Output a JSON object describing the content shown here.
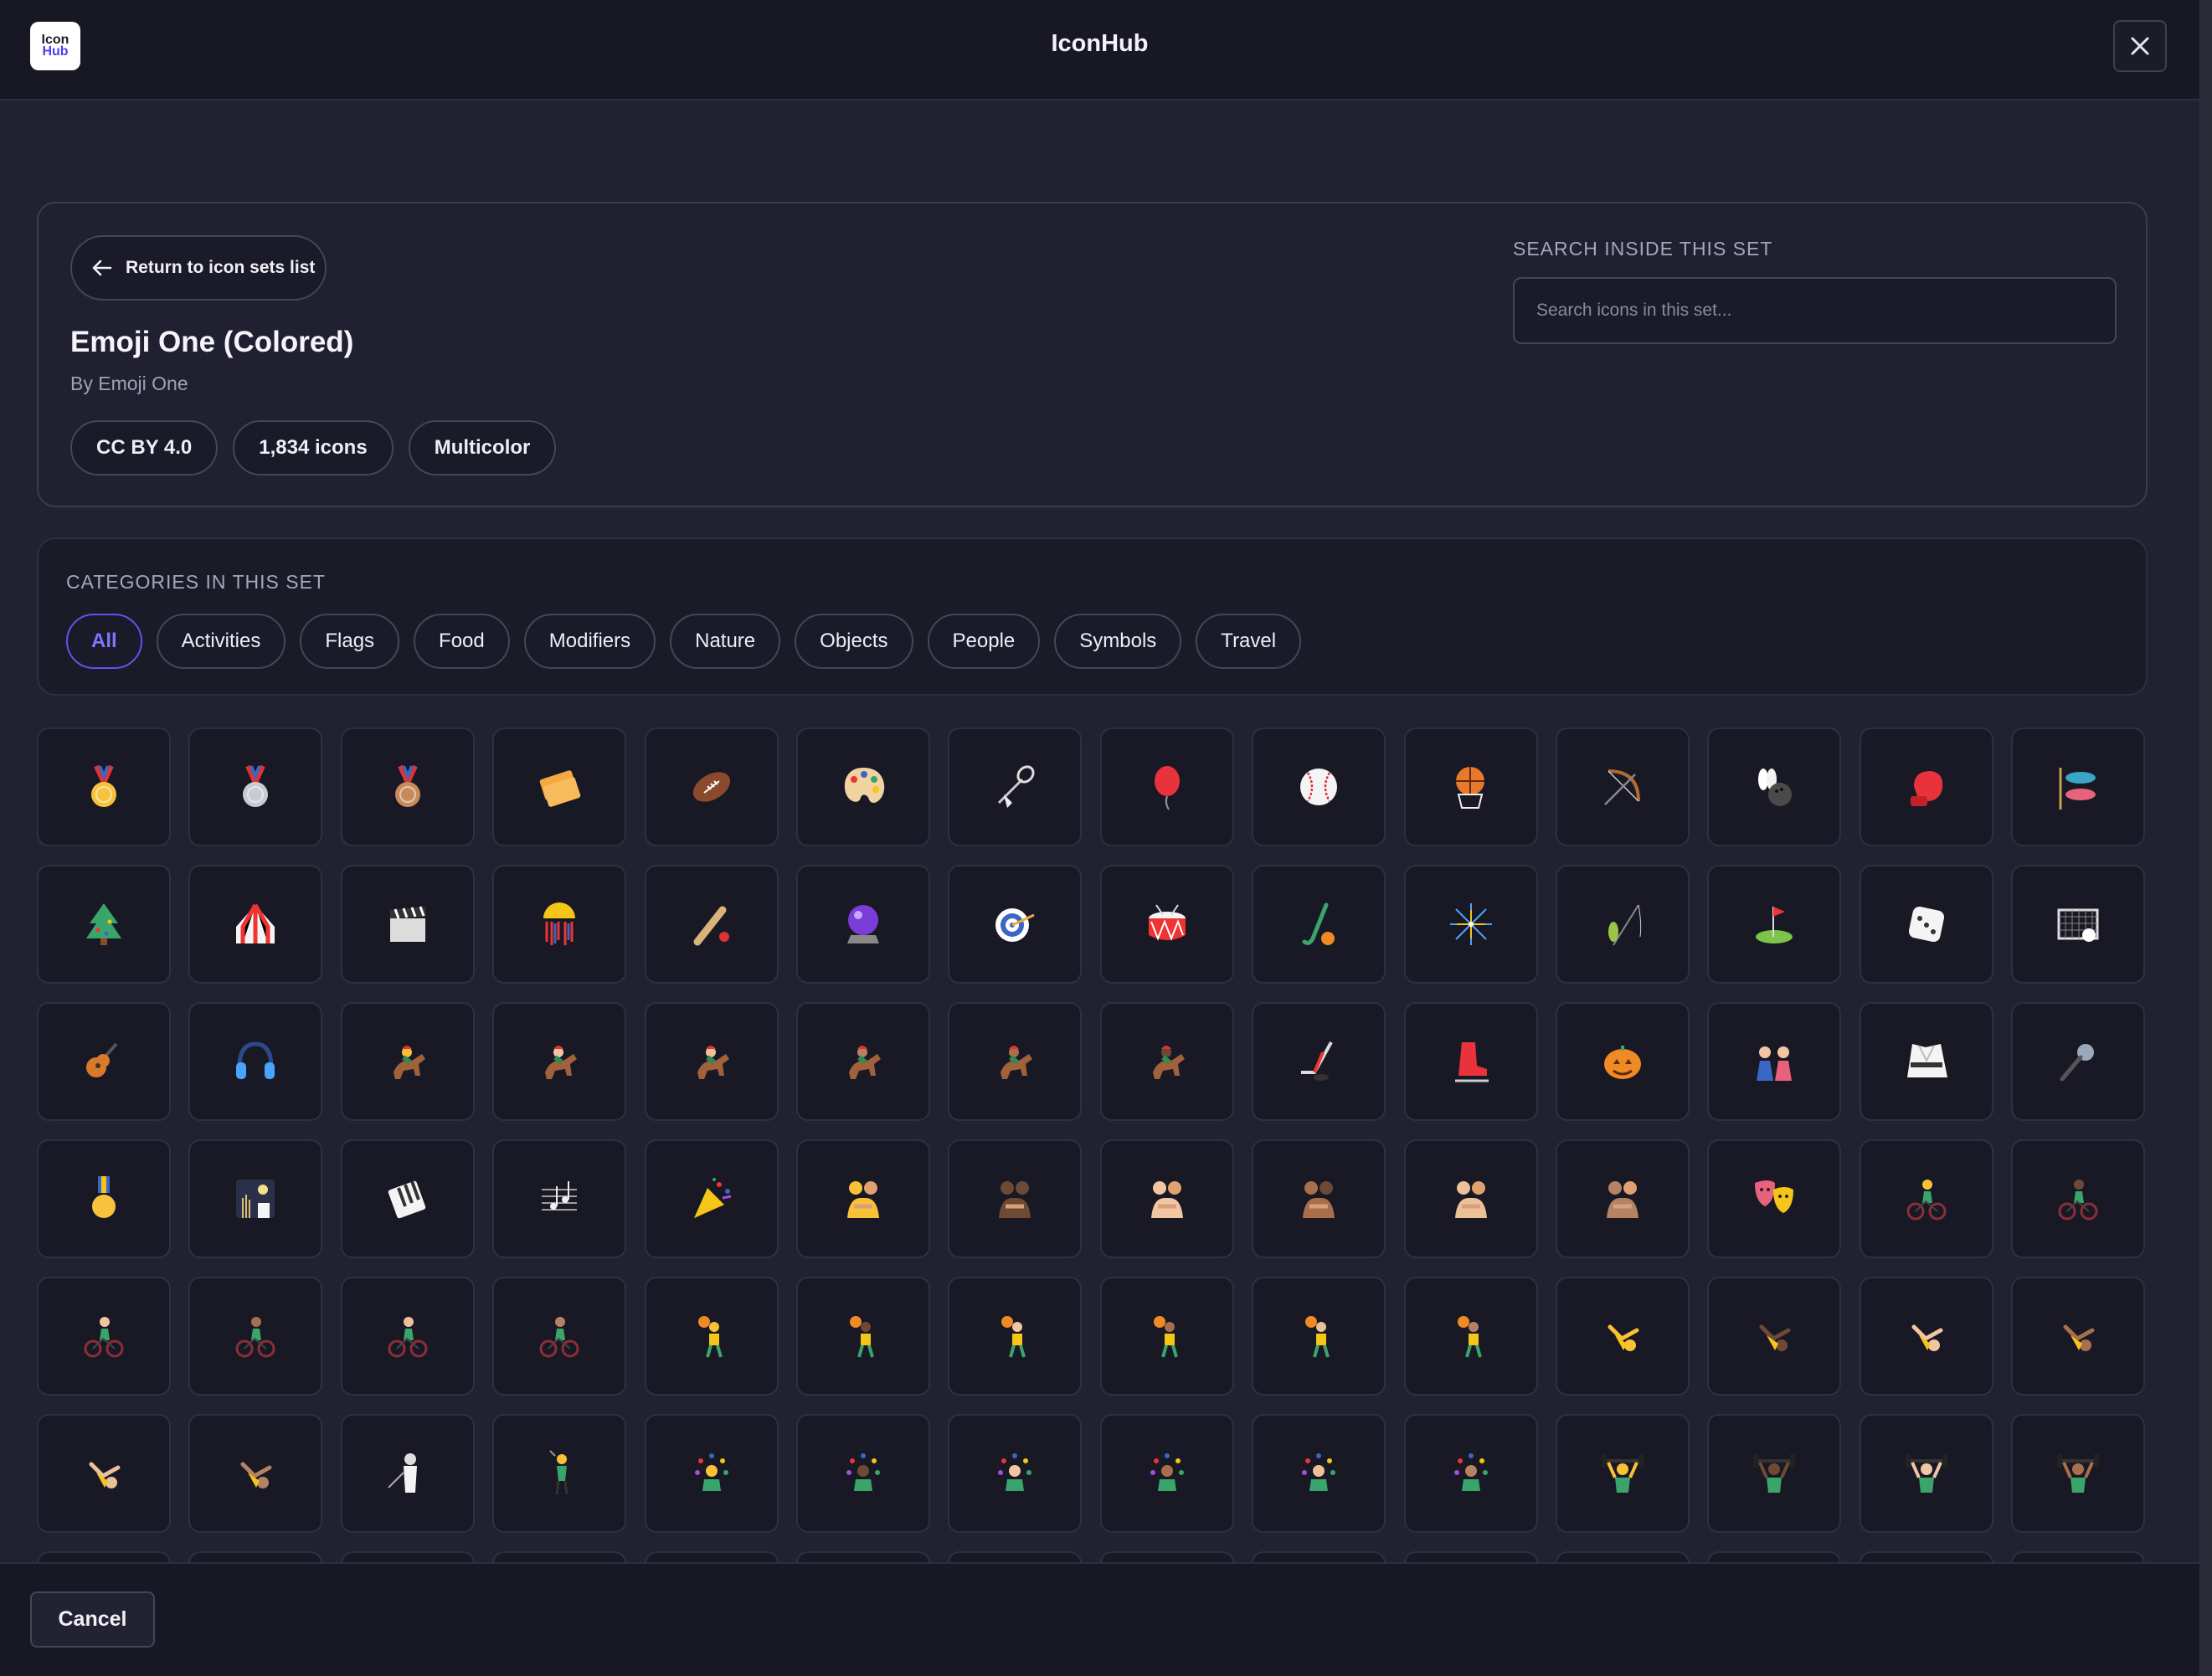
{
  "app": {
    "title": "IconHub",
    "logo_line1": "Icon",
    "logo_line2": "Hub"
  },
  "header": {
    "close_icon": "close-icon"
  },
  "set": {
    "back_label": "Return to icon sets list",
    "name": "Emoji One (Colored)",
    "author": "By Emoji One",
    "badges": [
      "CC BY 4.0",
      "1,834 icons",
      "Multicolor"
    ]
  },
  "search": {
    "label": "SEARCH INSIDE THIS SET",
    "placeholder": "Search icons in this set...",
    "value": ""
  },
  "categories": {
    "label": "CATEGORIES IN THIS SET",
    "items": [
      "All",
      "Activities",
      "Flags",
      "Food",
      "Modifiers",
      "Nature",
      "Objects",
      "People",
      "Symbols",
      "Travel"
    ],
    "active": "All"
  },
  "icons": [
    "medal-gold-icon",
    "medal-silver-icon",
    "medal-bronze-icon",
    "admission-tickets-icon",
    "american-football-icon",
    "artist-palette-icon",
    "badminton-icon",
    "balloon-icon",
    "baseball-icon",
    "basketball-icon",
    "bow-and-arrow-icon",
    "bowling-icon",
    "boxing-glove-icon",
    "carp-streamer-icon",
    "christmas-tree-icon",
    "circus-tent-icon",
    "clapper-board-icon",
    "confetti-ball-icon",
    "cricket-icon",
    "crystal-ball-icon",
    "direct-hit-icon",
    "drum-icon",
    "field-hockey-icon",
    "fireworks-icon",
    "fishing-pole-icon",
    "flag-in-hole-icon",
    "game-die-icon",
    "goal-net-icon",
    "guitar-icon",
    "headphone-icon",
    "horse-racing-icon",
    "horse-racing-light-icon",
    "horse-racing-medium-light-icon",
    "horse-racing-medium-icon",
    "horse-racing-medium-dark-icon",
    "horse-racing-dark-icon",
    "ice-hockey-icon",
    "ice-skate-icon",
    "jack-o-lantern-icon",
    "japanese-dolls-icon",
    "martial-arts-uniform-icon",
    "microphone-icon",
    "military-medal-icon",
    "moon-viewing-icon",
    "musical-keyboard-icon",
    "musical-score-icon",
    "party-popper-icon",
    "people-wrestling-icon",
    "people-wrestling-dark-icon",
    "people-wrestling-light-icon",
    "people-wrestling-medium-dark-icon",
    "people-wrestling-medium-light-icon",
    "people-wrestling-medium-icon",
    "performing-arts-icon",
    "person-biking-icon",
    "person-biking-dark-icon",
    "person-biking-light-icon",
    "person-biking-medium-dark-icon",
    "person-biking-medium-light-icon",
    "person-biking-medium-icon",
    "person-bouncing-ball-icon",
    "person-bouncing-ball-dark-icon",
    "person-bouncing-ball-light-icon",
    "person-bouncing-ball-medium-dark-icon",
    "person-bouncing-ball-medium-light-icon",
    "person-bouncing-ball-medium-icon",
    "person-cartwheeling-icon",
    "person-cartwheeling-dark-icon",
    "person-cartwheeling-light-icon",
    "person-cartwheeling-medium-dark-icon",
    "person-cartwheeling-medium-light-icon",
    "person-cartwheeling-medium-icon",
    "person-fencing-icon",
    "person-golfing-icon",
    "person-juggling-icon",
    "person-juggling-dark-icon",
    "person-juggling-light-icon",
    "person-juggling-medium-dark-icon",
    "person-juggling-medium-light-icon",
    "person-juggling-medium-icon",
    "person-lifting-weights-icon",
    "person-lifting-weights-dark-icon",
    "person-lifting-weights-light-icon",
    "person-lifting-weights-medium-dark-icon"
  ],
  "footer": {
    "cancel_label": "Cancel"
  }
}
